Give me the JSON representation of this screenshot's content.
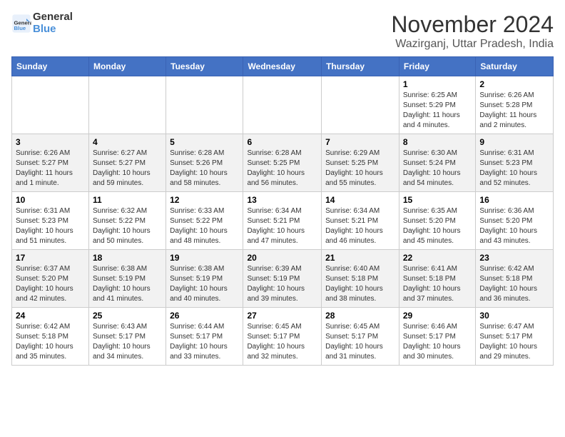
{
  "logo": {
    "line1": "General",
    "line2": "Blue"
  },
  "title": "November 2024",
  "location": "Wazirganj, Uttar Pradesh, India",
  "weekdays": [
    "Sunday",
    "Monday",
    "Tuesday",
    "Wednesday",
    "Thursday",
    "Friday",
    "Saturday"
  ],
  "weeks": [
    [
      {
        "day": "",
        "info": ""
      },
      {
        "day": "",
        "info": ""
      },
      {
        "day": "",
        "info": ""
      },
      {
        "day": "",
        "info": ""
      },
      {
        "day": "",
        "info": ""
      },
      {
        "day": "1",
        "info": "Sunrise: 6:25 AM\nSunset: 5:29 PM\nDaylight: 11 hours and 4 minutes."
      },
      {
        "day": "2",
        "info": "Sunrise: 6:26 AM\nSunset: 5:28 PM\nDaylight: 11 hours and 2 minutes."
      }
    ],
    [
      {
        "day": "3",
        "info": "Sunrise: 6:26 AM\nSunset: 5:27 PM\nDaylight: 11 hours and 1 minute."
      },
      {
        "day": "4",
        "info": "Sunrise: 6:27 AM\nSunset: 5:27 PM\nDaylight: 10 hours and 59 minutes."
      },
      {
        "day": "5",
        "info": "Sunrise: 6:28 AM\nSunset: 5:26 PM\nDaylight: 10 hours and 58 minutes."
      },
      {
        "day": "6",
        "info": "Sunrise: 6:28 AM\nSunset: 5:25 PM\nDaylight: 10 hours and 56 minutes."
      },
      {
        "day": "7",
        "info": "Sunrise: 6:29 AM\nSunset: 5:25 PM\nDaylight: 10 hours and 55 minutes."
      },
      {
        "day": "8",
        "info": "Sunrise: 6:30 AM\nSunset: 5:24 PM\nDaylight: 10 hours and 54 minutes."
      },
      {
        "day": "9",
        "info": "Sunrise: 6:31 AM\nSunset: 5:23 PM\nDaylight: 10 hours and 52 minutes."
      }
    ],
    [
      {
        "day": "10",
        "info": "Sunrise: 6:31 AM\nSunset: 5:23 PM\nDaylight: 10 hours and 51 minutes."
      },
      {
        "day": "11",
        "info": "Sunrise: 6:32 AM\nSunset: 5:22 PM\nDaylight: 10 hours and 50 minutes."
      },
      {
        "day": "12",
        "info": "Sunrise: 6:33 AM\nSunset: 5:22 PM\nDaylight: 10 hours and 48 minutes."
      },
      {
        "day": "13",
        "info": "Sunrise: 6:34 AM\nSunset: 5:21 PM\nDaylight: 10 hours and 47 minutes."
      },
      {
        "day": "14",
        "info": "Sunrise: 6:34 AM\nSunset: 5:21 PM\nDaylight: 10 hours and 46 minutes."
      },
      {
        "day": "15",
        "info": "Sunrise: 6:35 AM\nSunset: 5:20 PM\nDaylight: 10 hours and 45 minutes."
      },
      {
        "day": "16",
        "info": "Sunrise: 6:36 AM\nSunset: 5:20 PM\nDaylight: 10 hours and 43 minutes."
      }
    ],
    [
      {
        "day": "17",
        "info": "Sunrise: 6:37 AM\nSunset: 5:20 PM\nDaylight: 10 hours and 42 minutes."
      },
      {
        "day": "18",
        "info": "Sunrise: 6:38 AM\nSunset: 5:19 PM\nDaylight: 10 hours and 41 minutes."
      },
      {
        "day": "19",
        "info": "Sunrise: 6:38 AM\nSunset: 5:19 PM\nDaylight: 10 hours and 40 minutes."
      },
      {
        "day": "20",
        "info": "Sunrise: 6:39 AM\nSunset: 5:19 PM\nDaylight: 10 hours and 39 minutes."
      },
      {
        "day": "21",
        "info": "Sunrise: 6:40 AM\nSunset: 5:18 PM\nDaylight: 10 hours and 38 minutes."
      },
      {
        "day": "22",
        "info": "Sunrise: 6:41 AM\nSunset: 5:18 PM\nDaylight: 10 hours and 37 minutes."
      },
      {
        "day": "23",
        "info": "Sunrise: 6:42 AM\nSunset: 5:18 PM\nDaylight: 10 hours and 36 minutes."
      }
    ],
    [
      {
        "day": "24",
        "info": "Sunrise: 6:42 AM\nSunset: 5:18 PM\nDaylight: 10 hours and 35 minutes."
      },
      {
        "day": "25",
        "info": "Sunrise: 6:43 AM\nSunset: 5:17 PM\nDaylight: 10 hours and 34 minutes."
      },
      {
        "day": "26",
        "info": "Sunrise: 6:44 AM\nSunset: 5:17 PM\nDaylight: 10 hours and 33 minutes."
      },
      {
        "day": "27",
        "info": "Sunrise: 6:45 AM\nSunset: 5:17 PM\nDaylight: 10 hours and 32 minutes."
      },
      {
        "day": "28",
        "info": "Sunrise: 6:45 AM\nSunset: 5:17 PM\nDaylight: 10 hours and 31 minutes."
      },
      {
        "day": "29",
        "info": "Sunrise: 6:46 AM\nSunset: 5:17 PM\nDaylight: 10 hours and 30 minutes."
      },
      {
        "day": "30",
        "info": "Sunrise: 6:47 AM\nSunset: 5:17 PM\nDaylight: 10 hours and 29 minutes."
      }
    ]
  ]
}
